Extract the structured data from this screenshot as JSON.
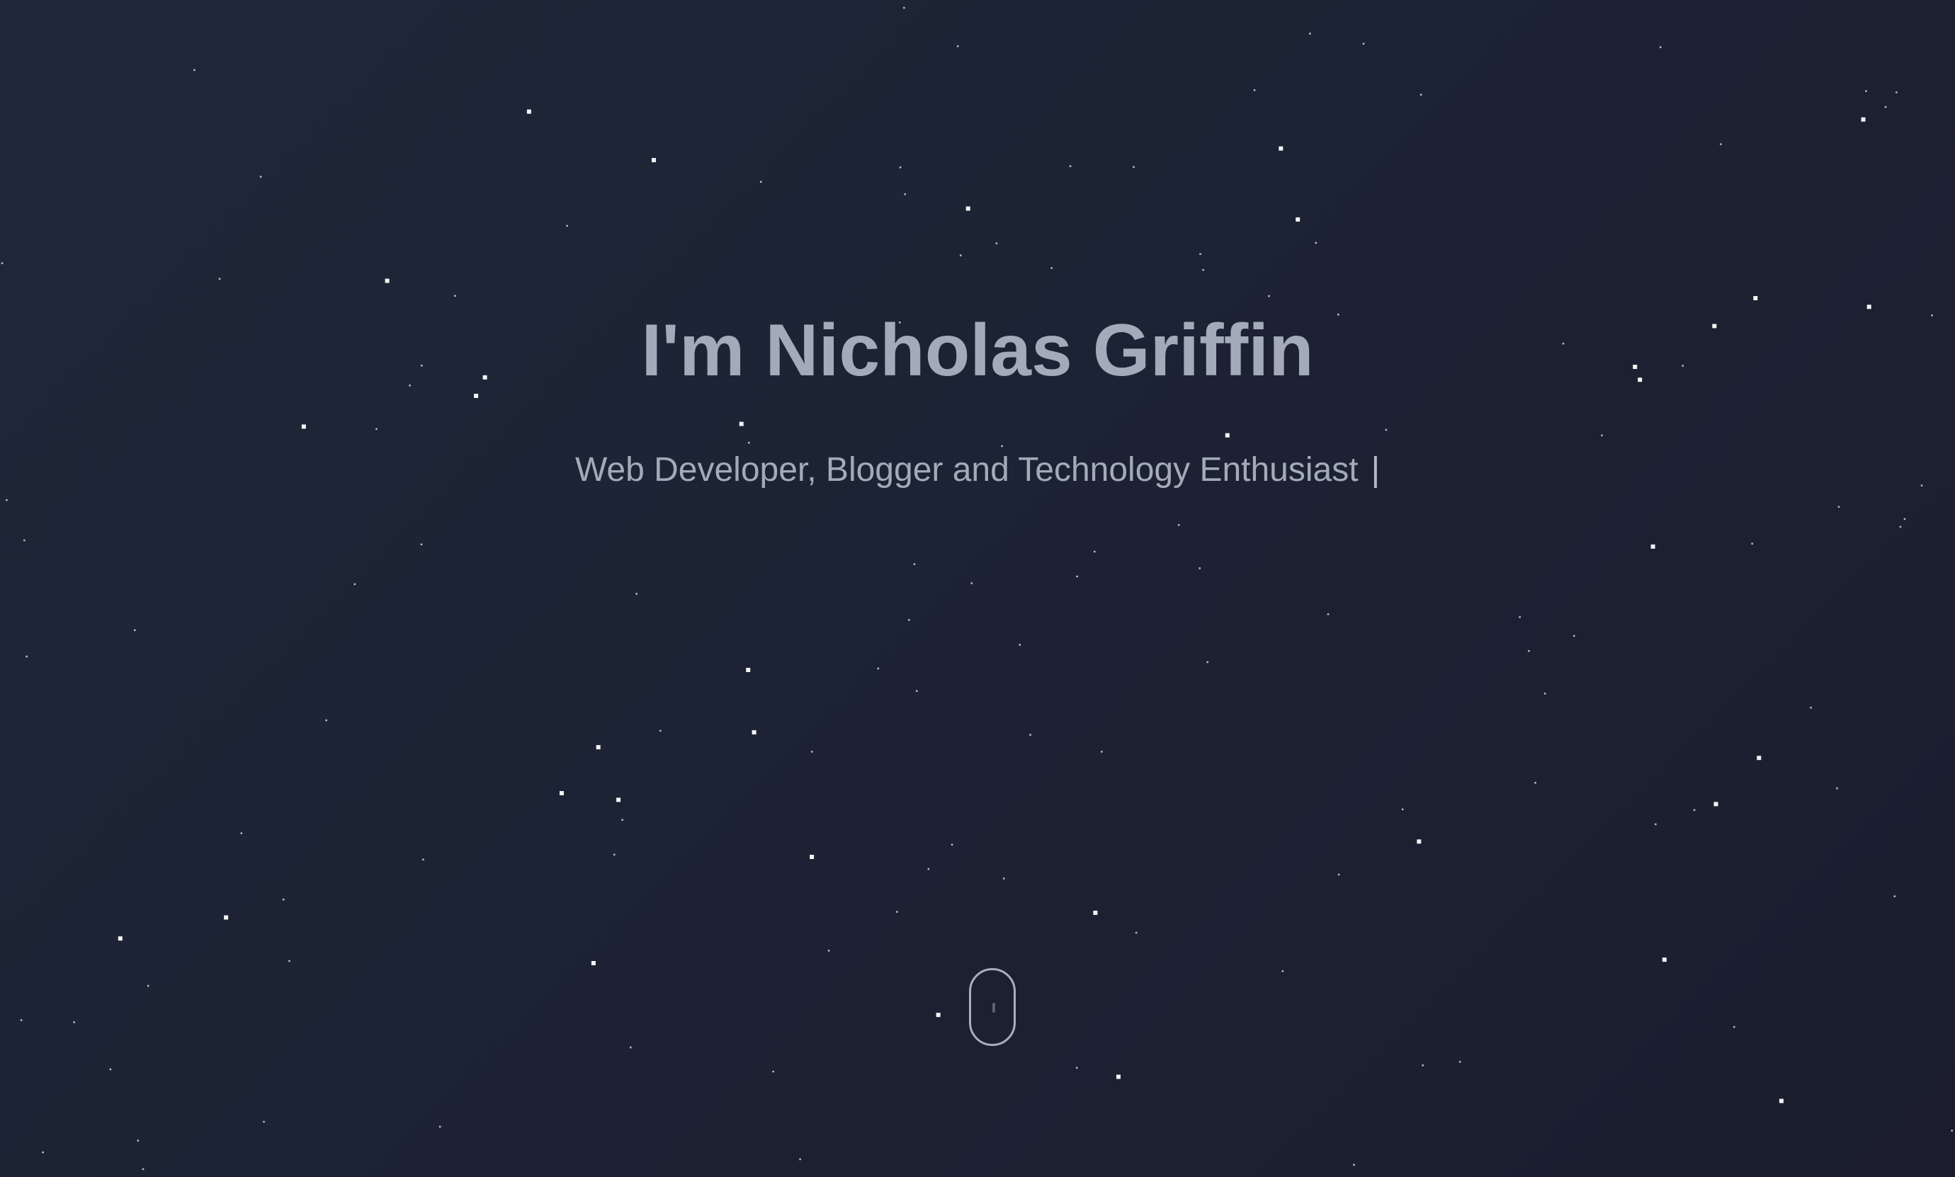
{
  "hero": {
    "title": "I'm Nicholas Griffin",
    "subtitle": "Web Developer, Blogger and Technology Enthusiast",
    "cursor": "|"
  },
  "scroll_indicator": {
    "icon": "mouse-scroll-icon"
  },
  "colors": {
    "background_start": "#1e2838",
    "background_end": "#1b1d2e",
    "text": "#a3aab8",
    "star": "#ffffff"
  }
}
